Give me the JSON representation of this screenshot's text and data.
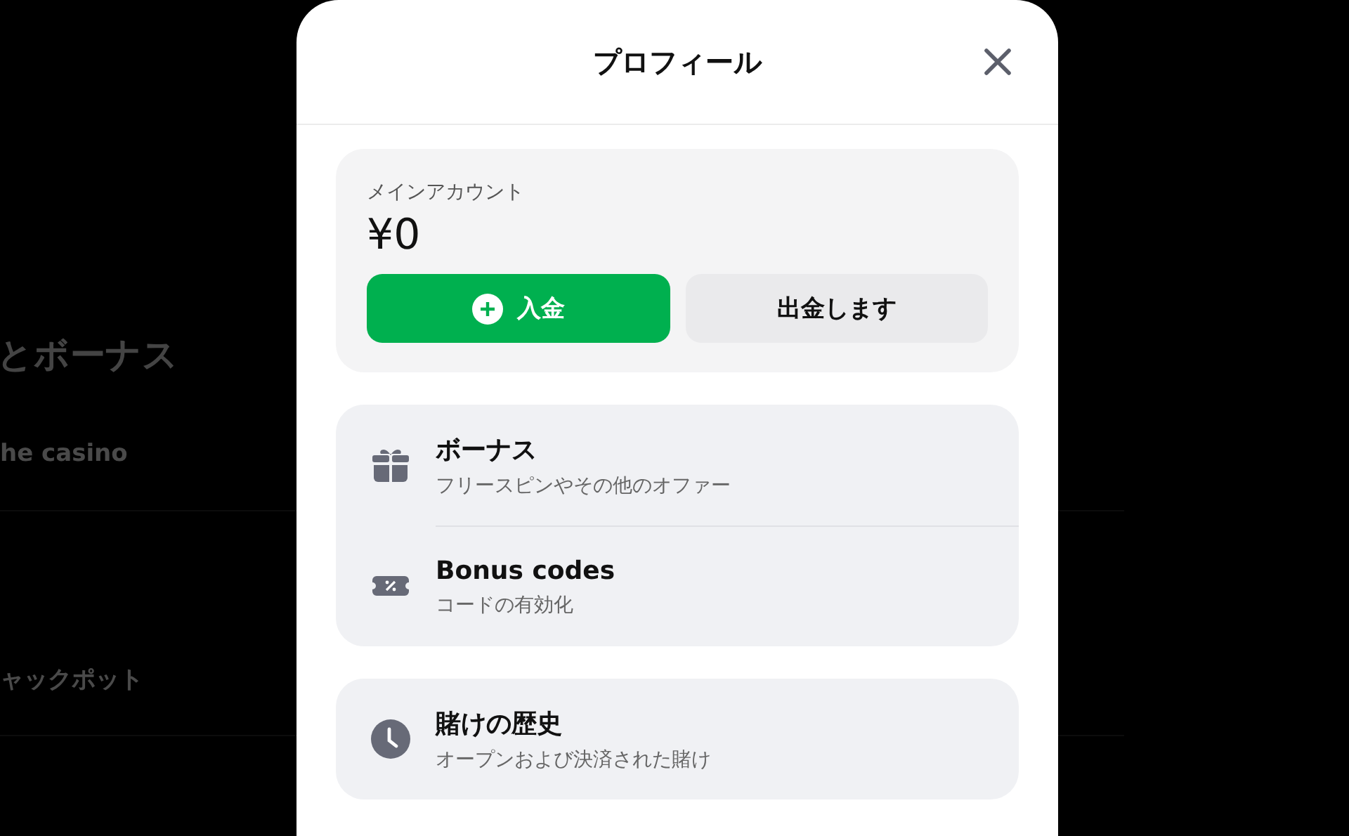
{
  "background": {
    "heading": "とボーナス",
    "items": [
      {
        "label": "he casino"
      },
      {
        "label": "ャックポット"
      }
    ]
  },
  "modal": {
    "title": "プロフィール",
    "account": {
      "label": "メインアカウント",
      "balance": "¥0",
      "buttons": [
        {
          "label": "入金",
          "kind": "primary"
        },
        {
          "label": "出金します",
          "kind": "secondary"
        }
      ]
    },
    "groups": [
      {
        "items": [
          {
            "kind": "gift",
            "title": "ボーナス",
            "subtitle": "フリースピンやその他のオファー"
          },
          {
            "kind": "coupon",
            "title": "Bonus codes",
            "subtitle": "コードの有効化"
          }
        ]
      },
      {
        "items": [
          {
            "kind": "clock",
            "title": "賭けの歴史",
            "subtitle": "オープンおよび決済された賭け"
          }
        ]
      }
    ]
  }
}
